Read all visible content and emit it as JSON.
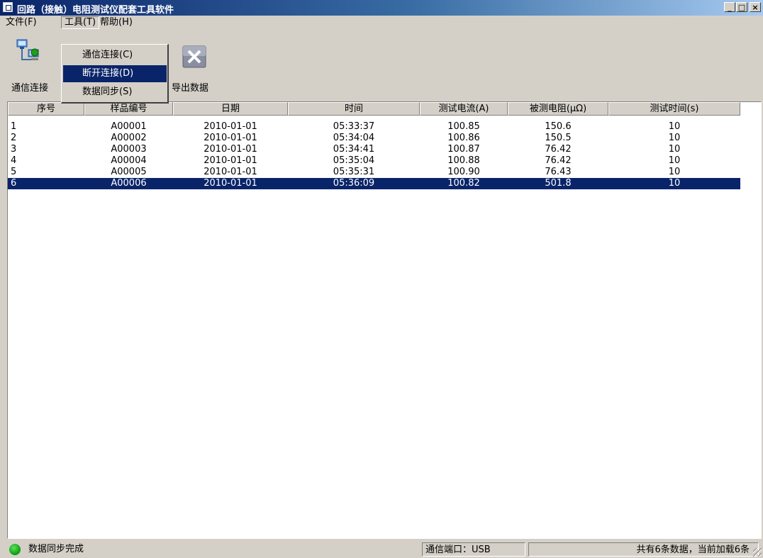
{
  "window": {
    "title": "回路（接触）电阻测试仪配套工具软件",
    "minimize": "_",
    "maximize": "□",
    "close": "×"
  },
  "menubar": {
    "file": "文件(F)",
    "tools": "工具(T)",
    "help": "帮助(H)"
  },
  "dropdown": {
    "items": [
      {
        "label": "通信连接(C)"
      },
      {
        "label": "断开连接(D)",
        "highlighted": true
      },
      {
        "label": "数据同步(S)"
      }
    ]
  },
  "toolbar": {
    "connect_label": "通信连接",
    "export_label": "导出数据"
  },
  "table": {
    "columns": [
      "序号",
      "样品编号",
      "日期",
      "时间",
      "测试电流(A)",
      "被测电阻(μΩ)",
      "测试时间(s)"
    ],
    "rows": [
      [
        "1",
        "A00001",
        "2010-01-01",
        "05:33:37",
        "100.85",
        "150.6",
        "10"
      ],
      [
        "2",
        "A00002",
        "2010-01-01",
        "05:34:04",
        "100.86",
        "150.5",
        "10"
      ],
      [
        "3",
        "A00003",
        "2010-01-01",
        "05:34:41",
        "100.87",
        "76.42",
        "10"
      ],
      [
        "4",
        "A00004",
        "2010-01-01",
        "05:35:04",
        "100.88",
        "76.42",
        "10"
      ],
      [
        "5",
        "A00005",
        "2010-01-01",
        "05:35:31",
        "100.90",
        "76.43",
        "10"
      ],
      [
        "6",
        "A00006",
        "2010-01-01",
        "05:36:09",
        "100.82",
        "501.8",
        "10"
      ]
    ],
    "selected_row": "6"
  },
  "statusbar": {
    "message": "数据同步完成",
    "port": "通信端口：USB",
    "count": "共有6条数据，当前加载6条"
  },
  "colors": {
    "selection": "#0a246a",
    "status_led": "#12b012",
    "face": "#d4d0c8"
  }
}
